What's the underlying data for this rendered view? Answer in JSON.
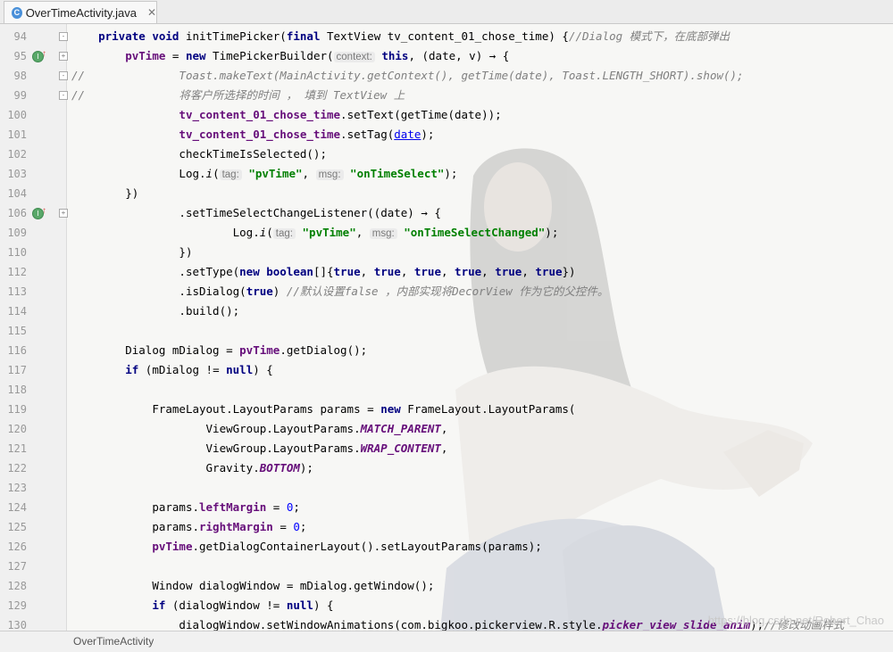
{
  "tab": {
    "icon_letter": "C",
    "title": "OverTimeActivity.java",
    "close": "✕"
  },
  "breadcrumb": "OverTimeActivity",
  "watermark": "https://blog.csdn.net/Robert_Chao",
  "colors": {
    "keyword": "#000080",
    "field": "#660e7a",
    "string": "#008000",
    "comment": "#808080",
    "hint_bg": "#ebebeb"
  },
  "lines": [
    {
      "num": "94",
      "marker": "",
      "fold": "-",
      "segments": [
        {
          "t": "    ",
          "c": "d"
        },
        {
          "t": "private void",
          "c": "kw"
        },
        {
          "t": " initTimePicker(",
          "c": "n"
        },
        {
          "t": "final",
          "c": "kw"
        },
        {
          "t": " TextView tv_content_01_chose_time) {",
          "c": "n"
        },
        {
          "t": "//Dialog 模式下，在底部弹出",
          "c": "cmt"
        }
      ]
    },
    {
      "num": "95",
      "marker": "impl",
      "fold": "+",
      "segments": [
        {
          "t": "        ",
          "c": "d"
        },
        {
          "t": "pvTime",
          "c": "fld"
        },
        {
          "t": " = ",
          "c": "n"
        },
        {
          "t": "new",
          "c": "kw"
        },
        {
          "t": " TimePickerBuilder(",
          "c": "n"
        },
        {
          "t": "context:",
          "c": "hint"
        },
        {
          "t": " ",
          "c": "n"
        },
        {
          "t": "this",
          "c": "kw"
        },
        {
          "t": ", (date, v) → {",
          "c": "n"
        }
      ]
    },
    {
      "num": "98",
      "marker": "",
      "fold": "-",
      "segments": [
        {
          "t": "//",
          "c": "cmt"
        },
        {
          "t": "              ",
          "c": "d"
        },
        {
          "t": "Toast.makeText(MainActivity.getContext(), getTime(date), Toast.LENGTH_SHORT).show();",
          "c": "cmt"
        }
      ]
    },
    {
      "num": "99",
      "marker": "",
      "fold": "-",
      "segments": [
        {
          "t": "//",
          "c": "cmt"
        },
        {
          "t": "              ",
          "c": "d"
        },
        {
          "t": "将客户所选择的时间 ， 填到 TextView 上",
          "c": "cmt"
        }
      ]
    },
    {
      "num": "100",
      "marker": "",
      "fold": "",
      "segments": [
        {
          "t": "                ",
          "c": "d"
        },
        {
          "t": "tv_content_01_chose_time",
          "c": "fld"
        },
        {
          "t": ".setText(getTime(date));",
          "c": "n"
        }
      ]
    },
    {
      "num": "101",
      "marker": "",
      "fold": "",
      "segments": [
        {
          "t": "                ",
          "c": "d"
        },
        {
          "t": "tv_content_01_chose_time",
          "c": "fld"
        },
        {
          "t": ".setTag(",
          "c": "n"
        },
        {
          "t": "date",
          "c": "lnk"
        },
        {
          "t": ");",
          "c": "n"
        }
      ]
    },
    {
      "num": "102",
      "marker": "",
      "fold": "",
      "segments": [
        {
          "t": "                ",
          "c": "d"
        },
        {
          "t": "checkTimeIsSelected();",
          "c": "n"
        }
      ]
    },
    {
      "num": "103",
      "marker": "",
      "fold": "",
      "segments": [
        {
          "t": "                ",
          "c": "d"
        },
        {
          "t": "Log.",
          "c": "n"
        },
        {
          "t": "i",
          "c": "it"
        },
        {
          "t": "(",
          "c": "n"
        },
        {
          "t": "tag:",
          "c": "hint"
        },
        {
          "t": " ",
          "c": "n"
        },
        {
          "t": "\"pvTime\"",
          "c": "str"
        },
        {
          "t": ", ",
          "c": "n"
        },
        {
          "t": "msg:",
          "c": "hint"
        },
        {
          "t": " ",
          "c": "n"
        },
        {
          "t": "\"onTimeSelect\"",
          "c": "str"
        },
        {
          "t": ");",
          "c": "n"
        }
      ]
    },
    {
      "num": "104",
      "marker": "",
      "fold": "",
      "segments": [
        {
          "t": "        ",
          "c": "d"
        },
        {
          "t": "})",
          "c": "n"
        }
      ]
    },
    {
      "num": "106",
      "marker": "impl",
      "fold": "+",
      "segments": [
        {
          "t": "                ",
          "c": "d"
        },
        {
          "t": ".setTimeSelectChangeListener((date) → {",
          "c": "n"
        }
      ]
    },
    {
      "num": "109",
      "marker": "",
      "fold": "",
      "segments": [
        {
          "t": "                        ",
          "c": "d"
        },
        {
          "t": "Log.",
          "c": "n"
        },
        {
          "t": "i",
          "c": "it"
        },
        {
          "t": "(",
          "c": "n"
        },
        {
          "t": "tag:",
          "c": "hint"
        },
        {
          "t": " ",
          "c": "n"
        },
        {
          "t": "\"pvTime\"",
          "c": "str"
        },
        {
          "t": ", ",
          "c": "n"
        },
        {
          "t": "msg:",
          "c": "hint"
        },
        {
          "t": " ",
          "c": "n"
        },
        {
          "t": "\"onTimeSelectChanged\"",
          "c": "str"
        },
        {
          "t": ");",
          "c": "n"
        }
      ]
    },
    {
      "num": "110",
      "marker": "",
      "fold": "",
      "segments": [
        {
          "t": "                ",
          "c": "d"
        },
        {
          "t": "})",
          "c": "n"
        }
      ]
    },
    {
      "num": "112",
      "marker": "",
      "fold": "",
      "segments": [
        {
          "t": "                ",
          "c": "d"
        },
        {
          "t": ".setType(",
          "c": "n"
        },
        {
          "t": "new boolean",
          "c": "kw"
        },
        {
          "t": "[]{",
          "c": "n"
        },
        {
          "t": "true",
          "c": "kw"
        },
        {
          "t": ", ",
          "c": "n"
        },
        {
          "t": "true",
          "c": "kw"
        },
        {
          "t": ", ",
          "c": "n"
        },
        {
          "t": "true",
          "c": "kw"
        },
        {
          "t": ", ",
          "c": "n"
        },
        {
          "t": "true",
          "c": "kw"
        },
        {
          "t": ", ",
          "c": "n"
        },
        {
          "t": "true",
          "c": "kw"
        },
        {
          "t": ", ",
          "c": "n"
        },
        {
          "t": "true",
          "c": "kw"
        },
        {
          "t": "})",
          "c": "n"
        }
      ]
    },
    {
      "num": "113",
      "marker": "",
      "fold": "",
      "segments": [
        {
          "t": "                ",
          "c": "d"
        },
        {
          "t": ".isDialog(",
          "c": "n"
        },
        {
          "t": "true",
          "c": "kw"
        },
        {
          "t": ") ",
          "c": "n"
        },
        {
          "t": "//默认设置false ，内部实现将DecorView 作为它的父控件。",
          "c": "cmt"
        }
      ]
    },
    {
      "num": "114",
      "marker": "",
      "fold": "",
      "segments": [
        {
          "t": "                ",
          "c": "d"
        },
        {
          "t": ".build();",
          "c": "n"
        }
      ]
    },
    {
      "num": "115",
      "marker": "",
      "fold": "",
      "segments": []
    },
    {
      "num": "116",
      "marker": "",
      "fold": "",
      "segments": [
        {
          "t": "        ",
          "c": "d"
        },
        {
          "t": "Dialog mDialog = ",
          "c": "n"
        },
        {
          "t": "pvTime",
          "c": "fld"
        },
        {
          "t": ".getDialog();",
          "c": "n"
        }
      ]
    },
    {
      "num": "117",
      "marker": "",
      "fold": "",
      "segments": [
        {
          "t": "        ",
          "c": "d"
        },
        {
          "t": "if",
          "c": "kw"
        },
        {
          "t": " (mDialog != ",
          "c": "n"
        },
        {
          "t": "null",
          "c": "kw"
        },
        {
          "t": ") {",
          "c": "n"
        }
      ]
    },
    {
      "num": "118",
      "marker": "",
      "fold": "",
      "segments": []
    },
    {
      "num": "119",
      "marker": "",
      "fold": "",
      "segments": [
        {
          "t": "            ",
          "c": "d"
        },
        {
          "t": "FrameLayout.LayoutParams params = ",
          "c": "n"
        },
        {
          "t": "new",
          "c": "kw"
        },
        {
          "t": " FrameLayout.LayoutParams(",
          "c": "n"
        }
      ]
    },
    {
      "num": "120",
      "marker": "",
      "fold": "",
      "segments": [
        {
          "t": "                    ",
          "c": "d"
        },
        {
          "t": "ViewGroup.LayoutParams.",
          "c": "n"
        },
        {
          "t": "MATCH_PARENT",
          "c": "sfld"
        },
        {
          "t": ",",
          "c": "n"
        }
      ]
    },
    {
      "num": "121",
      "marker": "",
      "fold": "",
      "segments": [
        {
          "t": "                    ",
          "c": "d"
        },
        {
          "t": "ViewGroup.LayoutParams.",
          "c": "n"
        },
        {
          "t": "WRAP_CONTENT",
          "c": "sfld"
        },
        {
          "t": ",",
          "c": "n"
        }
      ]
    },
    {
      "num": "122",
      "marker": "",
      "fold": "",
      "segments": [
        {
          "t": "                    ",
          "c": "d"
        },
        {
          "t": "Gravity.",
          "c": "n"
        },
        {
          "t": "BOTTOM",
          "c": "sfld"
        },
        {
          "t": ");",
          "c": "n"
        }
      ]
    },
    {
      "num": "123",
      "marker": "",
      "fold": "",
      "segments": []
    },
    {
      "num": "124",
      "marker": "",
      "fold": "",
      "segments": [
        {
          "t": "            ",
          "c": "d"
        },
        {
          "t": "params.",
          "c": "n"
        },
        {
          "t": "leftMargin",
          "c": "fld"
        },
        {
          "t": " = ",
          "c": "n"
        },
        {
          "t": "0",
          "c": "num"
        },
        {
          "t": ";",
          "c": "n"
        }
      ]
    },
    {
      "num": "125",
      "marker": "",
      "fold": "",
      "segments": [
        {
          "t": "            ",
          "c": "d"
        },
        {
          "t": "params.",
          "c": "n"
        },
        {
          "t": "rightMargin",
          "c": "fld"
        },
        {
          "t": " = ",
          "c": "n"
        },
        {
          "t": "0",
          "c": "num"
        },
        {
          "t": ";",
          "c": "n"
        }
      ]
    },
    {
      "num": "126",
      "marker": "",
      "fold": "",
      "segments": [
        {
          "t": "            ",
          "c": "d"
        },
        {
          "t": "pvTime",
          "c": "fld"
        },
        {
          "t": ".getDialogContainerLayout().setLayoutParams(params);",
          "c": "n"
        }
      ]
    },
    {
      "num": "127",
      "marker": "",
      "fold": "",
      "segments": []
    },
    {
      "num": "128",
      "marker": "",
      "fold": "",
      "segments": [
        {
          "t": "            ",
          "c": "d"
        },
        {
          "t": "Window dialogWindow = mDialog.getWindow();",
          "c": "n"
        }
      ]
    },
    {
      "num": "129",
      "marker": "",
      "fold": "",
      "segments": [
        {
          "t": "            ",
          "c": "d"
        },
        {
          "t": "if",
          "c": "kw"
        },
        {
          "t": " (dialogWindow != ",
          "c": "n"
        },
        {
          "t": "null",
          "c": "kw"
        },
        {
          "t": ") {",
          "c": "n"
        }
      ]
    },
    {
      "num": "130",
      "marker": "",
      "fold": "",
      "segments": [
        {
          "t": "                ",
          "c": "d"
        },
        {
          "t": "dialogWindow.setWindowAnimations(com.bigkoo.pickerview.R.style.",
          "c": "n"
        },
        {
          "t": "picker_view_slide_anim",
          "c": "sfld"
        },
        {
          "t": ");",
          "c": "n"
        },
        {
          "t": "//修改动画样式",
          "c": "cmt"
        }
      ]
    }
  ]
}
